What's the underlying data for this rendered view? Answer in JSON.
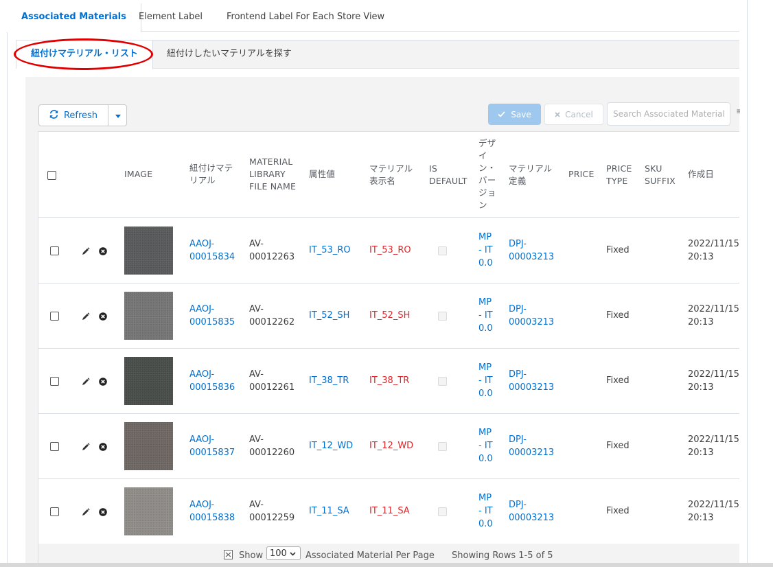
{
  "tabs": [
    {
      "label": "Associated Materials",
      "active": true
    },
    {
      "label": "Element Label",
      "active": false
    },
    {
      "label": "Frontend Label For Each Store View",
      "active": false
    }
  ],
  "subtabs": [
    {
      "label": "紐付けマテリアル・リスト",
      "active": true
    },
    {
      "label": "紐付けしたいマテリアルを探す",
      "active": false
    }
  ],
  "toolbar": {
    "refresh_label": "Refresh",
    "save_label": "Save",
    "cancel_label": "Cancel",
    "search_placeholder": "Search Associated Materials..."
  },
  "columns": {
    "image": "IMAGE",
    "material_1": "紐付けマテ",
    "material_2": "リアル",
    "libfile_1": "MATERIAL",
    "libfile_2": "LIBRARY",
    "libfile_3": "FILE NAME",
    "attribute": "属性値",
    "display_1": "マテリアル",
    "display_2": "表示名",
    "isdefault_1": "IS",
    "isdefault_2": "DEFAULT",
    "design_1": "デザ",
    "design_2": "イ",
    "design_3": "ン・",
    "design_4": "バー",
    "design_5": "ジョ",
    "design_6": "ン",
    "definition_1": "マテリアル",
    "definition_2": "定義",
    "price": "PRICE",
    "pricetype_1": "PRICE",
    "pricetype_2": "TYPE",
    "sku_1": "SKU",
    "sku_2": "SUFFIX",
    "created": "作成日"
  },
  "rows": [
    {
      "material_1": "AAOJ-",
      "material_2": "00015834",
      "lib_1": "AV-",
      "lib_2": "00012263",
      "attribute": "IT_53_RO",
      "display": "IT_53_RO",
      "design_1": "MP",
      "design_2": "- IT",
      "design_3": "0.0",
      "def_1": "DPJ-",
      "def_2": "00003213",
      "price": "",
      "price_type": "Fixed",
      "sku": "",
      "date": "2022/11/15",
      "time": "20:13",
      "swatch_color": "#58595a"
    },
    {
      "material_1": "AAOJ-",
      "material_2": "00015835",
      "lib_1": "AV-",
      "lib_2": "00012262",
      "attribute": "IT_52_SH",
      "display": "IT_52_SH",
      "design_1": "MP",
      "design_2": "- IT",
      "design_3": "0.0",
      "def_1": "DPJ-",
      "def_2": "00003213",
      "price": "",
      "price_type": "Fixed",
      "sku": "",
      "date": "2022/11/15",
      "time": "20:13",
      "swatch_color": "#747475"
    },
    {
      "material_1": "AAOJ-",
      "material_2": "00015836",
      "lib_1": "AV-",
      "lib_2": "00012261",
      "attribute": "IT_38_TR",
      "display": "IT_38_TR",
      "design_1": "MP",
      "design_2": "- IT",
      "design_3": "0.0",
      "def_1": "DPJ-",
      "def_2": "00003213",
      "price": "",
      "price_type": "Fixed",
      "sku": "",
      "date": "2022/11/15",
      "time": "20:13",
      "swatch_color": "#474c49"
    },
    {
      "material_1": "AAOJ-",
      "material_2": "00015837",
      "lib_1": "AV-",
      "lib_2": "00012260",
      "attribute": "IT_12_WD",
      "display": "IT_12_WD",
      "design_1": "MP",
      "design_2": "- IT",
      "design_3": "0.0",
      "def_1": "DPJ-",
      "def_2": "00003213",
      "price": "",
      "price_type": "Fixed",
      "sku": "",
      "date": "2022/11/15",
      "time": "20:13",
      "swatch_color": "#6c6561"
    },
    {
      "material_1": "AAOJ-",
      "material_2": "00015838",
      "lib_1": "AV-",
      "lib_2": "00012259",
      "attribute": "IT_11_SA",
      "display": "IT_11_SA",
      "design_1": "MP",
      "design_2": "- IT",
      "design_3": "0.0",
      "def_1": "DPJ-",
      "def_2": "00003213",
      "price": "",
      "price_type": "Fixed",
      "sku": "",
      "date": "2022/11/15",
      "time": "20:13",
      "swatch_color": "#8e8b87"
    }
  ],
  "footer": {
    "show_label": "Show",
    "per_page_value": "100",
    "per_page_suffix": "Associated Material Per Page",
    "showing_rows": "Showing Rows 1-5 of 5"
  },
  "colors": {
    "accent": "#0070d2",
    "highlight_red": "#e00000",
    "display_name_red": "#e0262a",
    "save_disabled": "#9fc8ee"
  },
  "icons": [
    "refresh-icon",
    "chevron-down-icon",
    "check-icon",
    "close-icon",
    "search-icon",
    "pencil-icon",
    "remove-circle-icon",
    "excel-icon"
  ]
}
